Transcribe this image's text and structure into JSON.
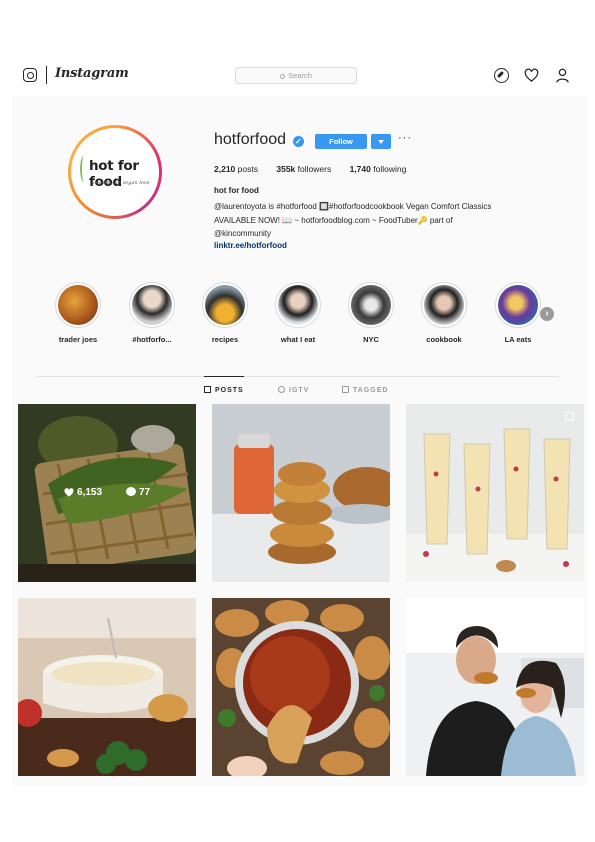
{
  "nav": {
    "logo": "Instagram",
    "search_placeholder": "Search",
    "icons": [
      "instagram-camera-icon",
      "explore-compass-icon",
      "activity-heart-icon",
      "profile-person-icon"
    ]
  },
  "profile": {
    "avatar_brand": "hot for food",
    "avatar_tagline": "cooking up vegan love",
    "username": "hotforfood",
    "verified_mark": "✓",
    "follow_label": "Follow",
    "more_label": "···",
    "stats": {
      "posts_count": "2,210",
      "posts_label": "posts",
      "followers_count": "355k",
      "followers_label": "followers",
      "following_count": "1,740",
      "following_label": "following"
    },
    "full_name": "hot for food",
    "bio_line1": "@laurentoyota is #hotforfood 🔲#hotforfoodcookbook Vegan Comfort Classics",
    "bio_line2": "AVAILABLE NOW! 📖 ~ hotforfoodblog.com ~ FoodTuber🔑 part of",
    "bio_line3": "@kincommunity",
    "link": "linktr.ee/hotforfood"
  },
  "highlights": [
    {
      "label": "trader joes"
    },
    {
      "label": "#hotforfo..."
    },
    {
      "label": "recipes"
    },
    {
      "label": "what I eat"
    },
    {
      "label": "NYC"
    },
    {
      "label": "cookbook"
    },
    {
      "label": "LA eats"
    }
  ],
  "tabs": [
    {
      "label": "POSTS",
      "active": true
    },
    {
      "label": "IGTV",
      "active": false
    },
    {
      "label": "TAGGED",
      "active": false
    }
  ],
  "posts": [
    {
      "likes": "6,153",
      "comments": "77"
    }
  ],
  "colors": {
    "accent_blue": "#3897f0",
    "link_blue": "#003569",
    "panel_bg": "#fafafa",
    "ring_gradient": [
      "#f9a13a",
      "#e1306c",
      "#c13584"
    ]
  }
}
